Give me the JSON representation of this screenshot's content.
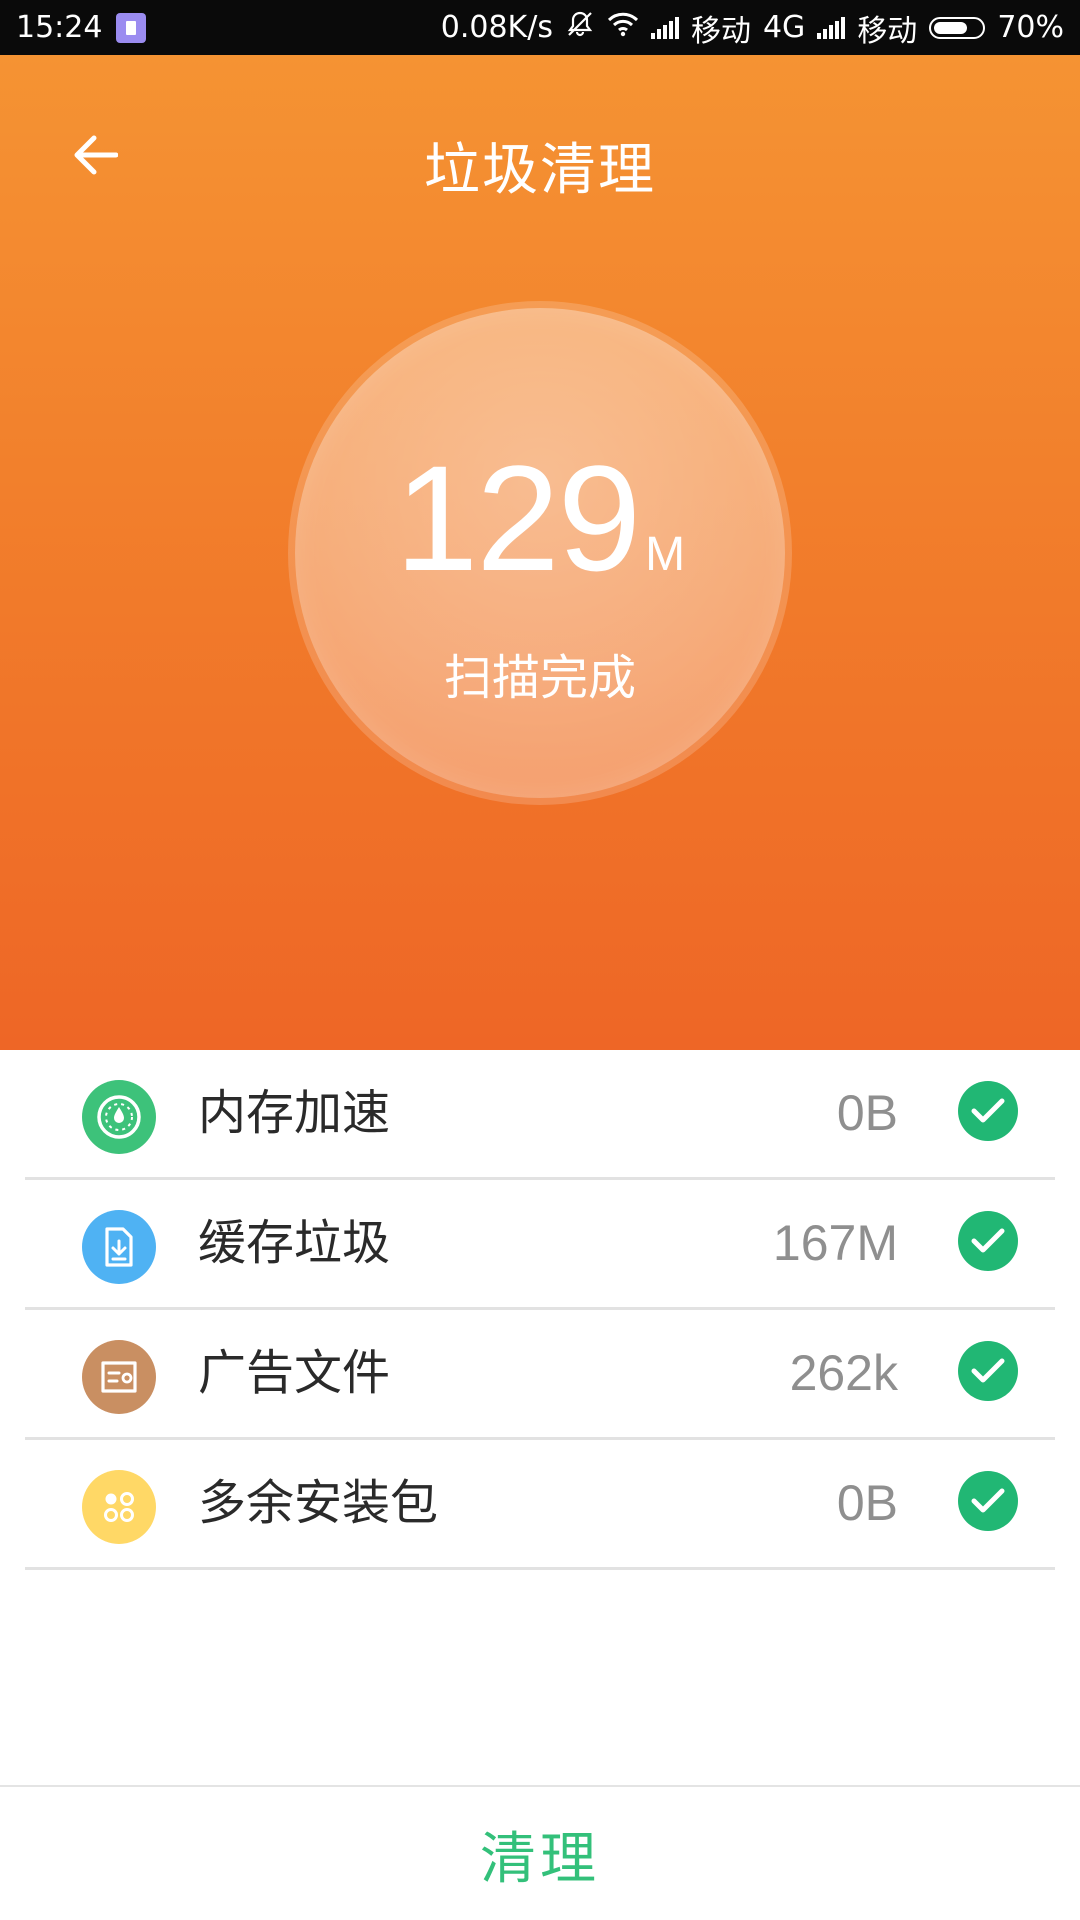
{
  "status_bar": {
    "time": "15:24",
    "speed": "0.08K/s",
    "carrier1": "移动",
    "network": "4G",
    "carrier2": "移动",
    "battery": "70%",
    "battery_level": 0.7,
    "app_icon": "notification-app-icon",
    "icons": [
      "mute-icon",
      "wifi-icon",
      "signal-icon"
    ]
  },
  "header": {
    "title": "垃圾清理",
    "back_icon": "arrow-left-icon",
    "gradient_top": "#f59333",
    "gradient_bottom": "#ee6626"
  },
  "scan": {
    "size_value": "129",
    "size_unit": "M",
    "status": "扫描完成"
  },
  "items": [
    {
      "label": "内存加速",
      "value": "0B",
      "icon": "speedometer-icon",
      "icon_color": "#3dc27a",
      "checked": true
    },
    {
      "label": "缓存垃圾",
      "value": "167M",
      "icon": "download-file-icon",
      "icon_color": "#4fb2f3",
      "checked": true
    },
    {
      "label": "广告文件",
      "value": "262k",
      "icon": "ad-file-icon",
      "icon_color": "#c98f62",
      "checked": true
    },
    {
      "label": "多余安装包",
      "value": "0B",
      "icon": "package-dots-icon",
      "icon_color": "#ffd866",
      "checked": true
    }
  ],
  "check_color": "#21b774",
  "actions": {
    "clean_label": "清理",
    "clean_color": "#33c07a"
  }
}
